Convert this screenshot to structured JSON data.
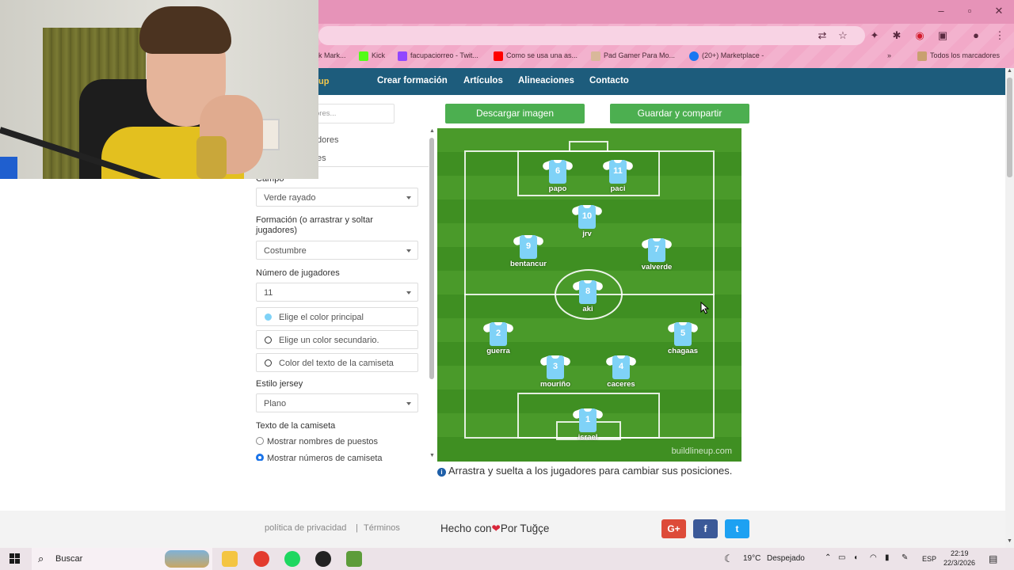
{
  "bookmarks": [
    {
      "label": "k Mark...",
      "color": "#e693b8"
    },
    {
      "label": "Kick",
      "color": "#53fc18"
    },
    {
      "label": "facupaciorreo - Twit...",
      "color": "#9146ff"
    },
    {
      "label": "Como se usa una as...",
      "color": "#ff0000"
    },
    {
      "label": "Pad Gamer Para Mo...",
      "color": "#d9b89a"
    },
    {
      "label": "(20+) Marketplace -",
      "color": "#1877f2"
    }
  ],
  "bookmarks_more": "»",
  "bookmarks_all": "Todos los marcadores",
  "site": {
    "logo_fragment": "up",
    "nav": [
      "Crear formación",
      "Artículos",
      "Alineaciones",
      "Contacto"
    ]
  },
  "search_placeholder": "ores...",
  "panel_tabs": [
    "dores",
    "es"
  ],
  "panel": {
    "campo_label": "Campo",
    "campo_value": "Verde rayado",
    "formacion_label": "Formación (o arrastrar y soltar jugadores)",
    "formacion_value": "Costumbre",
    "num_label": "Número de jugadores",
    "num_value": "11",
    "color_principal": "Elige el color principal",
    "color_secundario": "Elige un color secundario.",
    "color_texto": "Color del texto de la camiseta",
    "estilo_label": "Estilo jersey",
    "estilo_value": "Plano",
    "texto_label": "Texto de la camiseta",
    "radio_puestos": "Mostrar nombres de puestos",
    "radio_numeros": "Mostrar números de camiseta"
  },
  "buttons": {
    "download": "Descargar imagen",
    "save_share": "Guardar y compartir"
  },
  "pitch": {
    "watermark": "buildlineup.com",
    "shirt_color": "#7fd2f7",
    "players": [
      {
        "num": "6",
        "name": "papo"
      },
      {
        "num": "11",
        "name": "paci"
      },
      {
        "num": "10",
        "name": "jrv"
      },
      {
        "num": "9",
        "name": "bentancur"
      },
      {
        "num": "7",
        "name": "valverde"
      },
      {
        "num": "8",
        "name": "aki"
      },
      {
        "num": "2",
        "name": "guerra"
      },
      {
        "num": "5",
        "name": "chagaas"
      },
      {
        "num": "3",
        "name": "mouriño"
      },
      {
        "num": "4",
        "name": "caceres"
      },
      {
        "num": "1",
        "name": "israel"
      }
    ]
  },
  "hint": "Arrastra y suelta a los jugadores para cambiar sus posiciones.",
  "footer": {
    "privacy": "política de privacidad",
    "sep": "|",
    "terms": "Términos",
    "made_prefix": "Hecho con",
    "made_suffix": "Por Tuğçe",
    "social": [
      {
        "label": "G+",
        "color": "#dd4b39"
      },
      {
        "label": "f",
        "color": "#3b5998"
      },
      {
        "label": "t",
        "color": "#1da1f2"
      }
    ]
  },
  "taskbar": {
    "search": "Buscar",
    "weather_temp": "19°C",
    "weather_desc": "Despejado",
    "lang": "ESP",
    "time": "22:19",
    "date": "22/3/2026"
  }
}
